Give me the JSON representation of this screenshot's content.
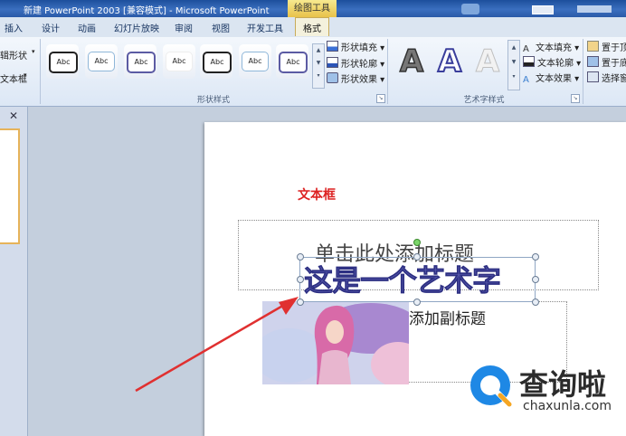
{
  "titlebar": {
    "title": "新建 PowerPoint 2003 [兼容模式] - Microsoft PowerPoint",
    "context_tab": "绘图工具"
  },
  "tabs": [
    "插入",
    "设计",
    "动画",
    "幻灯片放映",
    "审阅",
    "视图",
    "开发工具",
    "格式"
  ],
  "active_tab": "格式",
  "ribbon": {
    "left_partial": {
      "item1": "辑形状",
      "item2": "文本框"
    },
    "shape_styles": {
      "label": "形状样式",
      "presets": [
        "Abc",
        "Abc",
        "Abc",
        "Abc",
        "Abc",
        "Abc",
        "Abc"
      ],
      "fill": "形状填充",
      "outline": "形状轮廓",
      "effects": "形状效果"
    },
    "wordart_styles": {
      "label": "艺术字样式",
      "presets": [
        "A",
        "A",
        "A"
      ],
      "fill": "文本填充",
      "outline": "文本轮廓",
      "effects": "文本效果"
    },
    "arrange": {
      "item1": "置于顶",
      "item2": "置于底",
      "item3": "选择窗"
    }
  },
  "slide": {
    "textbox_label": "文本框",
    "title_placeholder": "单击此处添加标题",
    "wordart_text": "这是一个艺术字",
    "subtitle_placeholder": "添加副标题"
  },
  "watermark": {
    "brand": "查询啦",
    "url": "chaxunla.com"
  },
  "colors": {
    "annotation_red": "#e03030",
    "wordart_fill": "#5658ab",
    "ribbon_bg": "#dce7f5",
    "title_bar": "#2a5aa8",
    "active_tab_border": "#c7ab5a",
    "watermark_blue": "#1e88e5",
    "watermark_orange": "#f5a623"
  }
}
